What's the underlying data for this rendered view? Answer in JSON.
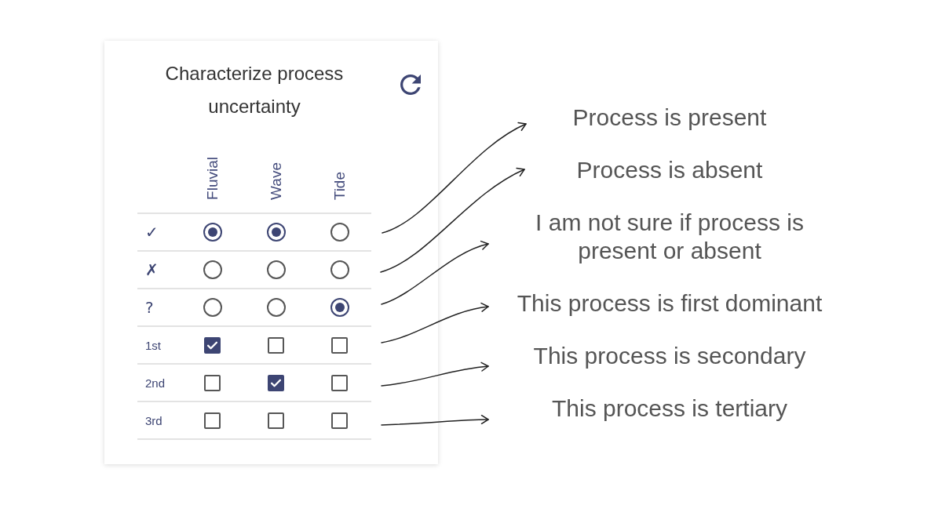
{
  "panel": {
    "title": "Characterize process uncertainty",
    "columns": [
      "Fluvial",
      "Wave",
      "Tide"
    ],
    "rows": [
      {
        "label": "✓",
        "kind": "radio",
        "cells": [
          {
            "selected": true
          },
          {
            "selected": true
          },
          {
            "selected": false
          }
        ]
      },
      {
        "label": "✗",
        "kind": "radio",
        "cells": [
          {
            "selected": false
          },
          {
            "selected": false
          },
          {
            "selected": false
          }
        ]
      },
      {
        "label": "?",
        "kind": "radio",
        "cells": [
          {
            "selected": false
          },
          {
            "selected": false
          },
          {
            "selected": true
          }
        ]
      },
      {
        "label": "1st",
        "kind": "checkbox",
        "cells": [
          {
            "checked": true
          },
          {
            "checked": false
          },
          {
            "checked": false
          }
        ]
      },
      {
        "label": "2nd",
        "kind": "checkbox",
        "cells": [
          {
            "checked": false
          },
          {
            "checked": true
          },
          {
            "checked": false
          }
        ]
      },
      {
        "label": "3rd",
        "kind": "checkbox",
        "cells": [
          {
            "checked": false
          },
          {
            "checked": false
          },
          {
            "checked": false
          }
        ]
      }
    ]
  },
  "annotations": [
    "Process is present",
    "Process is absent",
    "I am not sure if process is present or absent",
    "This process is first dominant",
    "This process is secondary",
    "This process is tertiary"
  ]
}
